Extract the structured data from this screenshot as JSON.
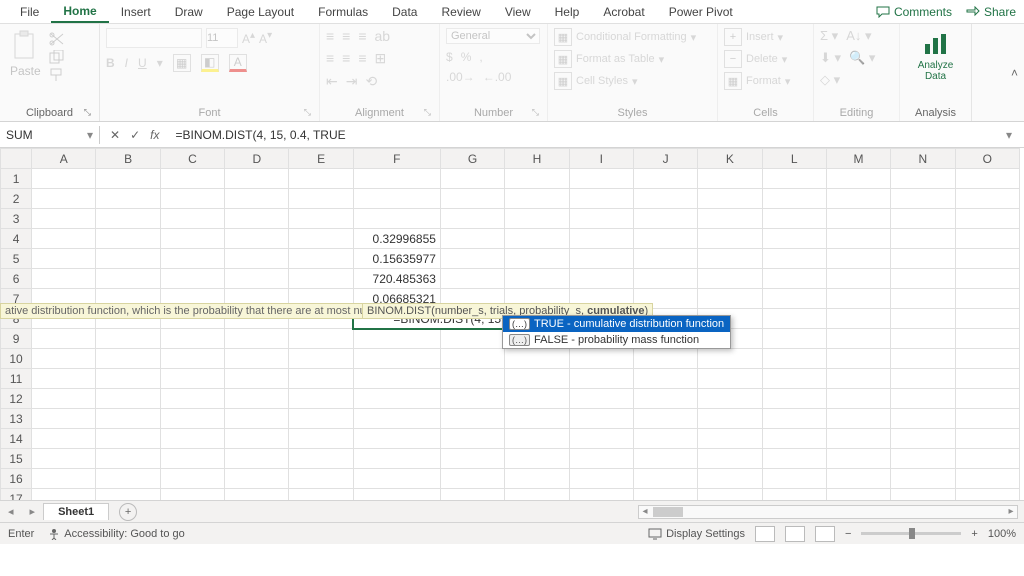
{
  "menu": {
    "tabs": [
      "File",
      "Home",
      "Insert",
      "Draw",
      "Page Layout",
      "Formulas",
      "Data",
      "Review",
      "View",
      "Help",
      "Acrobat",
      "Power Pivot"
    ],
    "active": "Home",
    "comments": "Comments",
    "share": "Share"
  },
  "ribbon": {
    "clipboard": {
      "paste": "Paste",
      "label": "Clipboard"
    },
    "font": {
      "name_placeholder": "",
      "size": "11",
      "label": "Font"
    },
    "alignment": {
      "label": "Alignment"
    },
    "number": {
      "format": "General",
      "label": "Number"
    },
    "styles": {
      "cond": "Conditional Formatting",
      "table": "Format as Table",
      "cell": "Cell Styles",
      "label": "Styles"
    },
    "cells": {
      "insert": "Insert",
      "delete": "Delete",
      "format": "Format",
      "label": "Cells"
    },
    "editing": {
      "label": "Editing"
    },
    "analysis": {
      "btn": "Analyze Data",
      "label": "Analysis"
    }
  },
  "formula": {
    "name_box": "SUM",
    "bar": "=BINOM.DIST(4, 15, 0.4, TRUE"
  },
  "columns": [
    "A",
    "B",
    "C",
    "D",
    "E",
    "F",
    "G",
    "H",
    "I",
    "J",
    "K",
    "L",
    "M",
    "N",
    "O"
  ],
  "rows": 17,
  "cells": {
    "F4": "0.32996855",
    "F5": "0.15635977",
    "F6": "720.485363",
    "F7": "0.06685321",
    "F8": "=BINOM.DIST(4, 15, 0.4, TRUE"
  },
  "hint": {
    "left_text": "ative distribution function, which is the probability that there are at most number_s successes",
    "signature_pre": "BINOM.DIST(number_s, trials, probability_s, ",
    "signature_bold": "cumulative",
    "signature_post": ")"
  },
  "autocomplete": {
    "items": [
      {
        "val": "TRUE",
        "desc": "cumulative distribution function",
        "selected": true
      },
      {
        "val": "FALSE",
        "desc": "probability mass function",
        "selected": false
      }
    ]
  },
  "sheets": {
    "active": "Sheet1"
  },
  "status": {
    "mode": "Enter",
    "accessibility": "Accessibility: Good to go",
    "display": "Display Settings",
    "zoom": "100%"
  },
  "colors": {
    "accent": "#217346"
  }
}
